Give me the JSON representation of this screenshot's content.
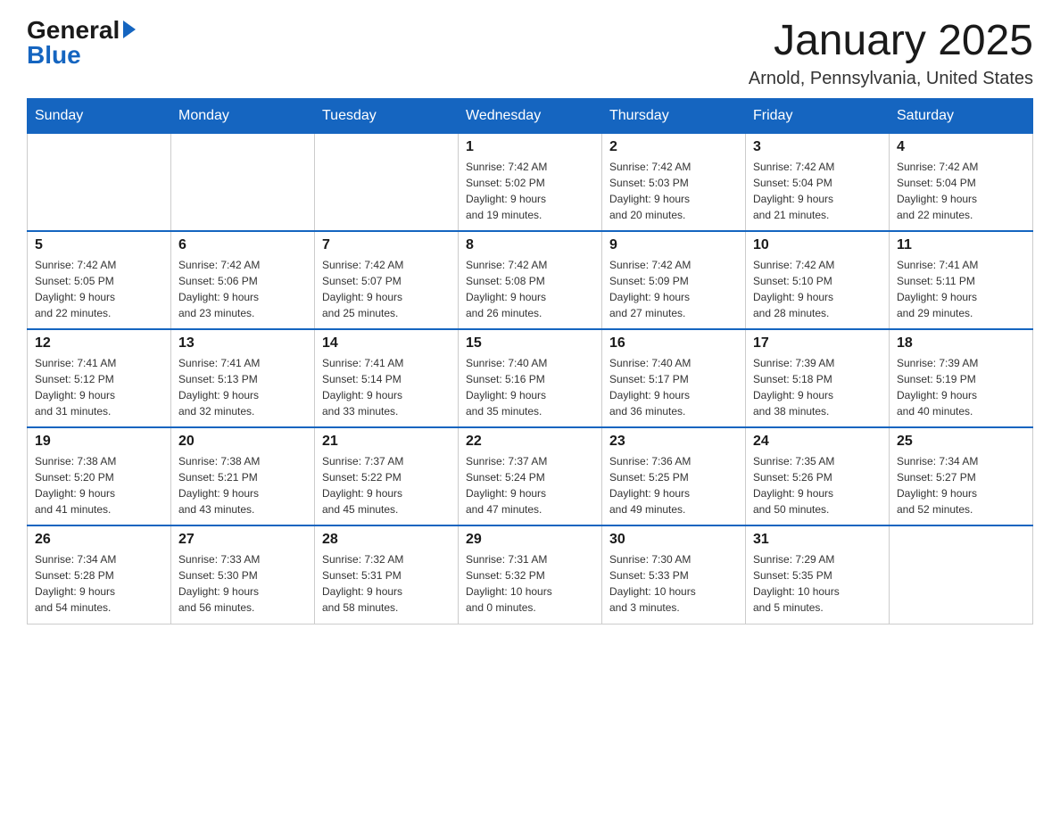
{
  "logo": {
    "general": "General",
    "blue": "Blue"
  },
  "title": "January 2025",
  "subtitle": "Arnold, Pennsylvania, United States",
  "days_of_week": [
    "Sunday",
    "Monday",
    "Tuesday",
    "Wednesday",
    "Thursday",
    "Friday",
    "Saturday"
  ],
  "weeks": [
    [
      {
        "day": "",
        "info": ""
      },
      {
        "day": "",
        "info": ""
      },
      {
        "day": "",
        "info": ""
      },
      {
        "day": "1",
        "info": "Sunrise: 7:42 AM\nSunset: 5:02 PM\nDaylight: 9 hours\nand 19 minutes."
      },
      {
        "day": "2",
        "info": "Sunrise: 7:42 AM\nSunset: 5:03 PM\nDaylight: 9 hours\nand 20 minutes."
      },
      {
        "day": "3",
        "info": "Sunrise: 7:42 AM\nSunset: 5:04 PM\nDaylight: 9 hours\nand 21 minutes."
      },
      {
        "day": "4",
        "info": "Sunrise: 7:42 AM\nSunset: 5:04 PM\nDaylight: 9 hours\nand 22 minutes."
      }
    ],
    [
      {
        "day": "5",
        "info": "Sunrise: 7:42 AM\nSunset: 5:05 PM\nDaylight: 9 hours\nand 22 minutes."
      },
      {
        "day": "6",
        "info": "Sunrise: 7:42 AM\nSunset: 5:06 PM\nDaylight: 9 hours\nand 23 minutes."
      },
      {
        "day": "7",
        "info": "Sunrise: 7:42 AM\nSunset: 5:07 PM\nDaylight: 9 hours\nand 25 minutes."
      },
      {
        "day": "8",
        "info": "Sunrise: 7:42 AM\nSunset: 5:08 PM\nDaylight: 9 hours\nand 26 minutes."
      },
      {
        "day": "9",
        "info": "Sunrise: 7:42 AM\nSunset: 5:09 PM\nDaylight: 9 hours\nand 27 minutes."
      },
      {
        "day": "10",
        "info": "Sunrise: 7:42 AM\nSunset: 5:10 PM\nDaylight: 9 hours\nand 28 minutes."
      },
      {
        "day": "11",
        "info": "Sunrise: 7:41 AM\nSunset: 5:11 PM\nDaylight: 9 hours\nand 29 minutes."
      }
    ],
    [
      {
        "day": "12",
        "info": "Sunrise: 7:41 AM\nSunset: 5:12 PM\nDaylight: 9 hours\nand 31 minutes."
      },
      {
        "day": "13",
        "info": "Sunrise: 7:41 AM\nSunset: 5:13 PM\nDaylight: 9 hours\nand 32 minutes."
      },
      {
        "day": "14",
        "info": "Sunrise: 7:41 AM\nSunset: 5:14 PM\nDaylight: 9 hours\nand 33 minutes."
      },
      {
        "day": "15",
        "info": "Sunrise: 7:40 AM\nSunset: 5:16 PM\nDaylight: 9 hours\nand 35 minutes."
      },
      {
        "day": "16",
        "info": "Sunrise: 7:40 AM\nSunset: 5:17 PM\nDaylight: 9 hours\nand 36 minutes."
      },
      {
        "day": "17",
        "info": "Sunrise: 7:39 AM\nSunset: 5:18 PM\nDaylight: 9 hours\nand 38 minutes."
      },
      {
        "day": "18",
        "info": "Sunrise: 7:39 AM\nSunset: 5:19 PM\nDaylight: 9 hours\nand 40 minutes."
      }
    ],
    [
      {
        "day": "19",
        "info": "Sunrise: 7:38 AM\nSunset: 5:20 PM\nDaylight: 9 hours\nand 41 minutes."
      },
      {
        "day": "20",
        "info": "Sunrise: 7:38 AM\nSunset: 5:21 PM\nDaylight: 9 hours\nand 43 minutes."
      },
      {
        "day": "21",
        "info": "Sunrise: 7:37 AM\nSunset: 5:22 PM\nDaylight: 9 hours\nand 45 minutes."
      },
      {
        "day": "22",
        "info": "Sunrise: 7:37 AM\nSunset: 5:24 PM\nDaylight: 9 hours\nand 47 minutes."
      },
      {
        "day": "23",
        "info": "Sunrise: 7:36 AM\nSunset: 5:25 PM\nDaylight: 9 hours\nand 49 minutes."
      },
      {
        "day": "24",
        "info": "Sunrise: 7:35 AM\nSunset: 5:26 PM\nDaylight: 9 hours\nand 50 minutes."
      },
      {
        "day": "25",
        "info": "Sunrise: 7:34 AM\nSunset: 5:27 PM\nDaylight: 9 hours\nand 52 minutes."
      }
    ],
    [
      {
        "day": "26",
        "info": "Sunrise: 7:34 AM\nSunset: 5:28 PM\nDaylight: 9 hours\nand 54 minutes."
      },
      {
        "day": "27",
        "info": "Sunrise: 7:33 AM\nSunset: 5:30 PM\nDaylight: 9 hours\nand 56 minutes."
      },
      {
        "day": "28",
        "info": "Sunrise: 7:32 AM\nSunset: 5:31 PM\nDaylight: 9 hours\nand 58 minutes."
      },
      {
        "day": "29",
        "info": "Sunrise: 7:31 AM\nSunset: 5:32 PM\nDaylight: 10 hours\nand 0 minutes."
      },
      {
        "day": "30",
        "info": "Sunrise: 7:30 AM\nSunset: 5:33 PM\nDaylight: 10 hours\nand 3 minutes."
      },
      {
        "day": "31",
        "info": "Sunrise: 7:29 AM\nSunset: 5:35 PM\nDaylight: 10 hours\nand 5 minutes."
      },
      {
        "day": "",
        "info": ""
      }
    ]
  ]
}
